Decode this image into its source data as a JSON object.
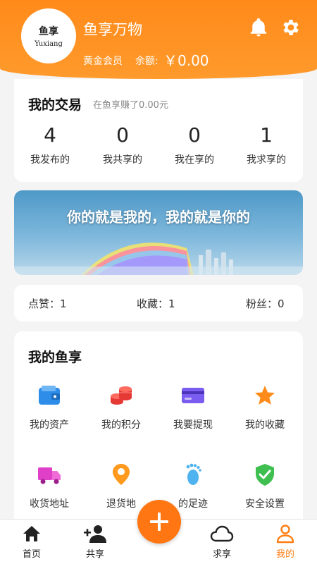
{
  "header": {
    "avatar_line1": "鱼享",
    "avatar_line2": "Yuxiang",
    "username": "鱼享万物",
    "member_level": "黄金会员",
    "balance_label": "余额:",
    "balance_value": "￥0.00",
    "bell_icon": "bell-icon",
    "settings_icon": "gear-icon"
  },
  "trade": {
    "title": "我的交易",
    "subtitle": "在鱼享赚了0.00元",
    "stats": [
      {
        "value": "4",
        "label": "我发布的"
      },
      {
        "value": "0",
        "label": "我共享的"
      },
      {
        "value": "0",
        "label": "我在享的"
      },
      {
        "value": "1",
        "label": "我求享的"
      }
    ]
  },
  "banner": {
    "text": "你的就是我的，我的就是你的"
  },
  "counts": {
    "likes": "点赞：1",
    "favorites": "收藏：1",
    "fans": "粉丝：0"
  },
  "my_fish": {
    "title": "我的鱼享",
    "items": [
      {
        "label": "我的资产",
        "icon": "wallet-icon"
      },
      {
        "label": "我的积分",
        "icon": "coins-icon"
      },
      {
        "label": "我要提现",
        "icon": "card-icon"
      },
      {
        "label": "我的收藏",
        "icon": "star-icon"
      },
      {
        "label": "收货地址",
        "icon": "truck-icon"
      },
      {
        "label": "退货地",
        "icon": "location-pin-icon"
      },
      {
        "label": "的足迹",
        "icon": "footprint-icon"
      },
      {
        "label": "安全设置",
        "icon": "shield-check-icon"
      }
    ]
  },
  "nav": {
    "items": [
      {
        "label": "首页",
        "icon": "home-icon"
      },
      {
        "label": "共享",
        "icon": "add-user-icon"
      },
      {
        "label": "求享",
        "icon": "cloud-icon"
      },
      {
        "label": "我的",
        "icon": "person-icon"
      }
    ],
    "fab_icon": "plus-icon"
  },
  "colors": {
    "accent": "#ff7f16",
    "header": "#ff8a1a"
  }
}
